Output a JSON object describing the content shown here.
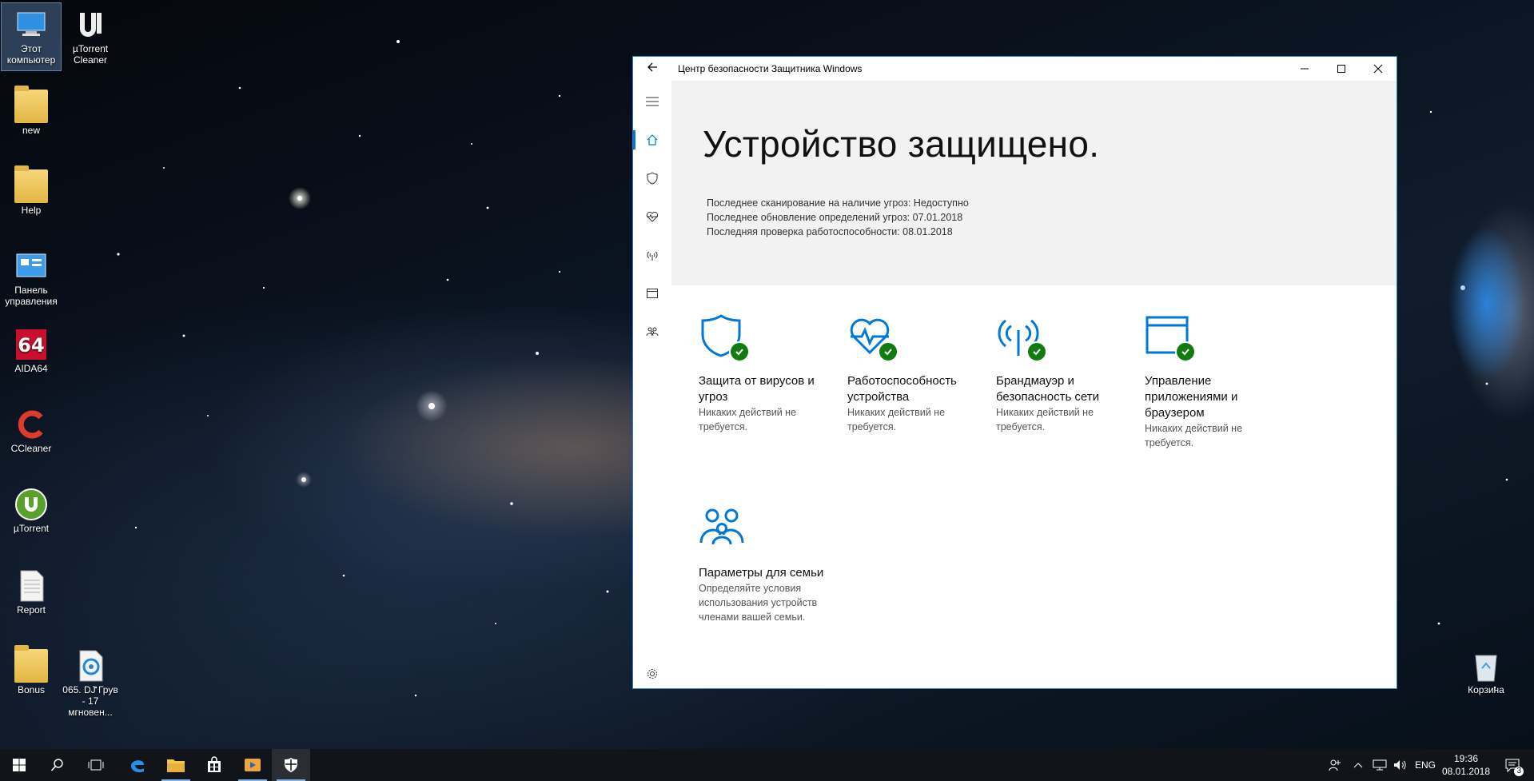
{
  "desktop": {
    "icons": [
      {
        "label": "Этот компьютер"
      },
      {
        "label": "µTorrent Cleaner"
      },
      {
        "label": "new"
      },
      {
        "label": "Help"
      },
      {
        "label": "Панель управления"
      },
      {
        "label": "AIDA64"
      },
      {
        "label": "CCleaner"
      },
      {
        "label": "µTorrent"
      },
      {
        "label": "Report"
      },
      {
        "label": "Bonus"
      },
      {
        "label": "065. DJ Грув - 17 мгновен..."
      },
      {
        "label": "Корзина"
      }
    ]
  },
  "window": {
    "title": "Центр безопасности Защитника Windows",
    "hero": {
      "heading": "Устройство защищено.",
      "status": [
        "Последнее сканирование на наличие угроз: Недоступно",
        "Последнее обновление определений угроз: 07.01.2018",
        "Последняя проверка работоспособности: 08.01.2018"
      ]
    },
    "tiles": [
      {
        "title": "Защита от вирусов и угроз",
        "desc": "Никаких действий не требуется.",
        "icon": "shield-icon"
      },
      {
        "title": "Работоспособность устройства",
        "desc": "Никаких действий не требуется.",
        "icon": "heart-pulse-icon"
      },
      {
        "title": "Брандмауэр и безопасность сети",
        "desc": "Никаких действий не требуется.",
        "icon": "antenna-icon"
      },
      {
        "title": "Управление приложениями и браузером",
        "desc": "Никаких действий не требуется.",
        "icon": "browser-window-icon"
      },
      {
        "title": "Параметры для семьи",
        "desc": "Определяйте условия использования устройств членами вашей семьи.",
        "icon": "family-icon"
      }
    ]
  },
  "taskbar": {
    "language": "ENG",
    "time": "19:36",
    "date": "08.01.2018",
    "notifications": "3"
  },
  "colors": {
    "accent": "#0078d7",
    "ok_badge": "#107c10",
    "hero_bg": "#f2f2f2",
    "taskbar_bg": "#111418"
  }
}
